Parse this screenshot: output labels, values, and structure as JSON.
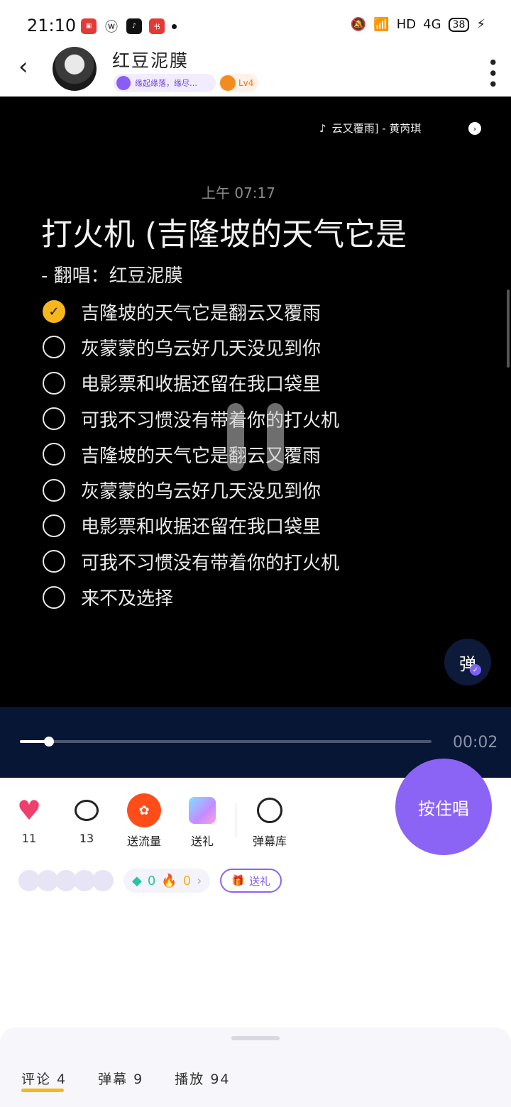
{
  "status_bar": {
    "time": "21:10",
    "app_icons": [
      "video-app-icon",
      "weibo-icon",
      "tiktok-icon",
      "xiaohongshu-icon"
    ],
    "network": "HD",
    "signal": "4G",
    "battery": "38"
  },
  "header": {
    "username": "红豆泥膜",
    "badge_text": "缘起缘落，缘尽…",
    "level": "Lv4"
  },
  "video": {
    "music": "云又覆雨] - 黄芮琪",
    "time_label": "上午 07:17",
    "title": "打火机 (吉隆坡的天气它是",
    "subtitle": "-  翻唱：红豆泥膜",
    "lyrics": [
      {
        "text": "吉隆坡的天气它是翻云又覆雨",
        "checked": true
      },
      {
        "text": "灰蒙蒙的乌云好几天没见到你",
        "checked": false
      },
      {
        "text": "电影票和收据还留在我口袋里",
        "checked": false
      },
      {
        "text": "可我不习惯没有带着你的打火机",
        "checked": false
      },
      {
        "text": "吉隆坡的天气它是翻云又覆雨",
        "checked": false
      },
      {
        "text": "灰蒙蒙的乌云好几天没见到你",
        "checked": false
      },
      {
        "text": "电影票和收据还留在我口袋里",
        "checked": false
      },
      {
        "text": "可我不习惯没有带着你的打火机",
        "checked": false
      },
      {
        "text": "来不及选择",
        "checked": false
      }
    ],
    "danmu_button": "弹"
  },
  "player": {
    "progress": 0.07,
    "elapsed": "00:02"
  },
  "sing_button": "按住唱",
  "actions": {
    "likes": "11",
    "comments": "13",
    "flow_label": "送流量",
    "gift_label": "送礼",
    "danmu_lib_label": "弹幕库"
  },
  "gift_row": {
    "gems": "0",
    "flames": "0",
    "send_gift": "送礼"
  },
  "tabs": [
    {
      "label": "评论 4",
      "active": true
    },
    {
      "label": "弹幕 9",
      "active": false
    },
    {
      "label": "播放 94",
      "active": false
    }
  ],
  "colors": {
    "accent_purple": "#8b64f5",
    "check_yellow": "#f6b61e",
    "heart_red": "#ef3f6c",
    "flow_orange": "#ff4d1a"
  }
}
